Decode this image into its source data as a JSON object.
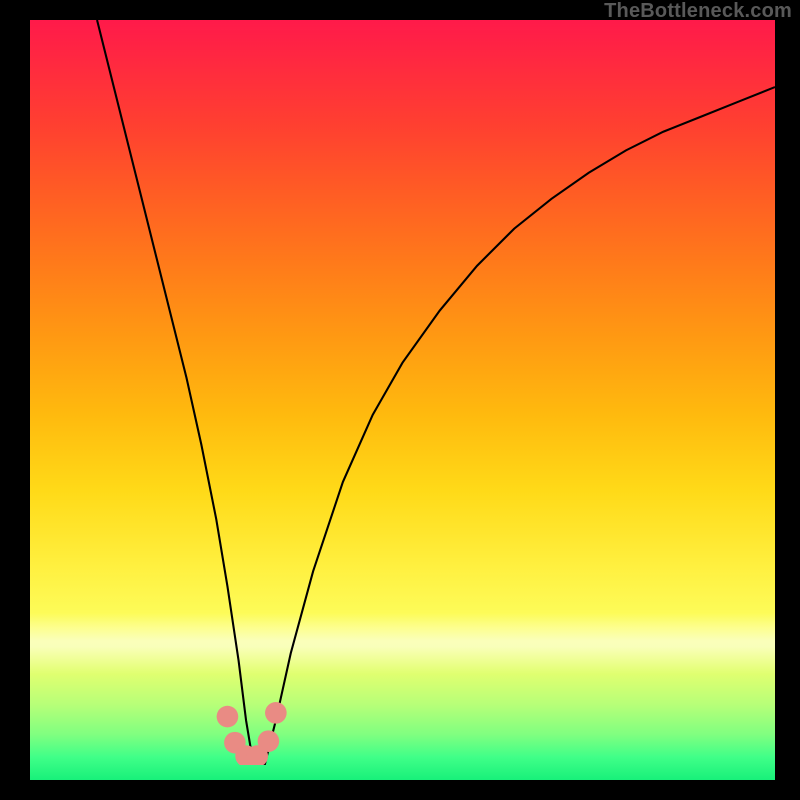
{
  "watermark": "TheBottleneck.com",
  "chart_data": {
    "type": "line",
    "title": "",
    "xlabel": "",
    "ylabel": "",
    "xlim": [
      0,
      100
    ],
    "ylim": [
      0,
      100
    ],
    "grid": false,
    "legend": false,
    "series": [
      {
        "name": "bottleneck-curve",
        "color": "#000000",
        "x": [
          9,
          11,
          13,
          15,
          17,
          19,
          21,
          23,
          25,
          26.5,
          28,
          29,
          30,
          31.5,
          33,
          35,
          38,
          42,
          46,
          50,
          55,
          60,
          65,
          70,
          75,
          80,
          85,
          90,
          95,
          100
        ],
        "y": [
          100,
          92,
          84,
          76,
          68,
          60,
          52,
          43,
          33,
          24,
          14,
          6,
          0,
          0,
          6,
          15,
          26,
          38,
          47,
          54,
          61,
          67,
          72,
          76,
          79.5,
          82.5,
          85,
          87,
          89,
          91
        ]
      }
    ],
    "markers": [
      {
        "name": "marker-pink",
        "shape": "rounded",
        "color": "#e98b84",
        "points": [
          {
            "x": 26.5,
            "y": 6.5
          },
          {
            "x": 27.5,
            "y": 3.0
          },
          {
            "x": 29.0,
            "y": 1.2
          },
          {
            "x": 30.5,
            "y": 1.2
          },
          {
            "x": 32.0,
            "y": 3.2
          },
          {
            "x": 33.0,
            "y": 7.0
          }
        ]
      }
    ],
    "background_gradient": {
      "direction": "vertical",
      "stops": [
        {
          "pos": 0.0,
          "color": "#ff1a4a"
        },
        {
          "pos": 0.5,
          "color": "#ffb70e"
        },
        {
          "pos": 0.8,
          "color": "#fcff60"
        },
        {
          "pos": 1.0,
          "color": "#18f07a"
        }
      ]
    }
  }
}
